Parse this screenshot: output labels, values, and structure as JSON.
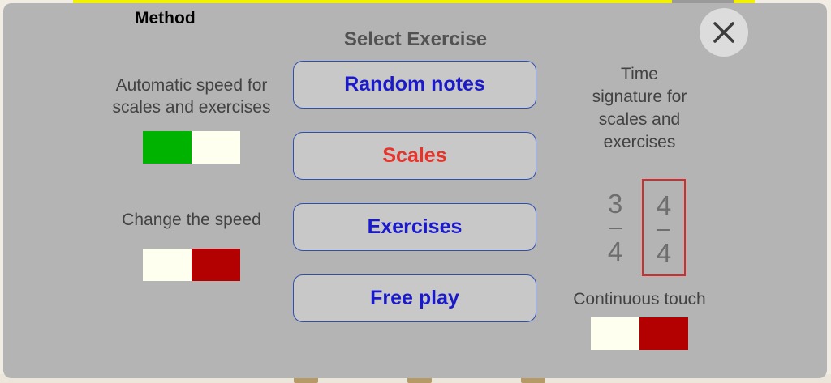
{
  "panel": {
    "method_title": "Method",
    "select_title": "Select Exercise",
    "close_icon": "close-icon"
  },
  "left": {
    "auto_speed_label": "Automatic speed for scales and exercises",
    "auto_speed_toggle": {
      "state": "on",
      "left_color": "#00b300",
      "right_color": "#fffff0"
    },
    "change_speed_label": "Change the speed",
    "change_speed_toggle": {
      "state": "off",
      "left_color": "#fffff0",
      "right_color": "#b30000"
    }
  },
  "exercises": [
    {
      "label": "Random notes",
      "selected": false
    },
    {
      "label": "Scales",
      "selected": true
    },
    {
      "label": "Exercises",
      "selected": false
    },
    {
      "label": "Free play",
      "selected": false
    }
  ],
  "right": {
    "time_signature_label": "Time signature for scales and exercises",
    "time_signatures": [
      {
        "top": "3",
        "bottom": "4",
        "selected": false
      },
      {
        "top": "4",
        "bottom": "4",
        "selected": true
      }
    ],
    "continuous_touch_label": "Continuous touch",
    "continuous_touch_toggle": {
      "state": "off",
      "left_color": "#fffff0",
      "right_color": "#b30000"
    }
  },
  "colors": {
    "accent_blue": "#1a1acc",
    "selected_red": "#e8332b",
    "background_yellow": "#f2f200"
  }
}
